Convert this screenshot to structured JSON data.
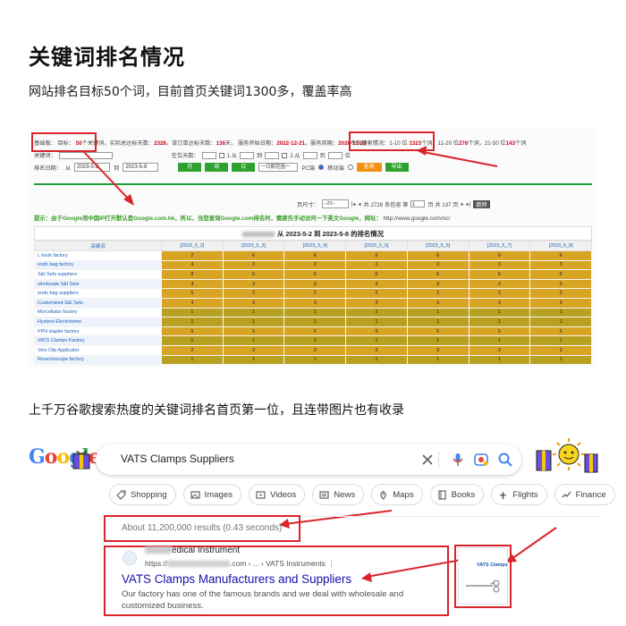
{
  "page": {
    "title": "关键词排名情况",
    "subtitle": "网站排名目标50个词，目前首页关键词1300多，覆盖率高",
    "section2_heading": "上千万谷歌搜索热度的关键词排名首页第一位，且连带图片也有收录"
  },
  "rank_panel": {
    "basic_label": "基础版：",
    "target_label": "目标：",
    "target_value": "50",
    "target_suffix": "个关键词",
    "days_text": "，实际总达标天数：",
    "days_value": "2328",
    "left_days_text": "，该订单达标天数：",
    "left_days_value": "136",
    "days_unit": "天，",
    "service_start_label": "服务开始日期：",
    "service_start": "2022-12-21",
    "service_end_label": "，服务到期：",
    "service_end": "2026-12-20",
    "today_label": "今日搜索情况：1-10 位",
    "today_top10": "1323",
    "today_mid_text": "个词，11-20 位",
    "today_11_20": "276",
    "today_mid2_text": "个词，21-50 位",
    "today_21_50": "143",
    "today_tail": "个词",
    "keyword_label": "关键词：",
    "position_label": "在位天数：",
    "range_label": "1.从",
    "to_label": "到",
    "range2_label": "2.从",
    "pos_unit": "位",
    "date_label": "排名日期：",
    "from_label": "从",
    "date_from": "2023-5-2",
    "date_to": "2023-5-8",
    "btn_month": "月",
    "btn_week": "周",
    "btn_day": "日",
    "period_select": "一日期范围一",
    "pc_label": "PC端",
    "mobile_label": "移动端",
    "btn_query": "查询",
    "btn_export": "导出",
    "pager_size_label": "页尺寸：",
    "pager_size": "--20--",
    "pager_total": "共 2728 条信息 第",
    "pager_page": "1",
    "pager_pages": "页 共 137 页",
    "pager_go": "跳转",
    "tip": "提示：由于Google用中国IP打开默认是Google.com.hk，所以，当您查询Google.com排名时，需要先手动访问一下英文Google，网址：",
    "tip_url": "http://www.google.com/ncr",
    "table_title": "从 2023-5-2 到 2023-5-8 的排名情况",
    "columns": [
      "关键词",
      "[2023_5_2]",
      "[2023_5_3]",
      "[2023_5_4]",
      "[2023_5_5]",
      "[2023_5_6]",
      "[2023_5_7]",
      "[2023_5_8]"
    ],
    "rows": [
      {
        "kw": "L hook factory",
        "v": [
          "2",
          "6",
          "6",
          "6",
          "6",
          "6",
          "6"
        ]
      },
      {
        "kw": "endo bag factory",
        "v": [
          "4",
          "3",
          "3",
          "3",
          "3",
          "3",
          "3"
        ]
      },
      {
        "kw": "S&I Sets suppliers",
        "v": [
          "8",
          "6",
          "6",
          "6",
          "6",
          "6",
          "6"
        ]
      },
      {
        "kw": "wholesale S&I Sets",
        "v": [
          "4",
          "3",
          "3",
          "3",
          "3",
          "3",
          "3"
        ]
      },
      {
        "kw": "endo bag suppliers",
        "v": [
          "5",
          "2",
          "2",
          "2",
          "2",
          "2",
          "2"
        ]
      },
      {
        "kw": "Customized S&I Sets",
        "v": [
          "4",
          "3",
          "3",
          "3",
          "3",
          "3",
          "3"
        ]
      },
      {
        "kw": "Morcellator factory",
        "v": [
          "1",
          "1",
          "1",
          "1",
          "1",
          "1",
          "1"
        ]
      },
      {
        "kw": "Hystero-Electrotome",
        "v": [
          "1",
          "1",
          "1",
          "1",
          "1",
          "1",
          "1"
        ]
      },
      {
        "kw": "PPH stapler factory",
        "v": [
          "5",
          "5",
          "5",
          "5",
          "5",
          "5",
          "5"
        ]
      },
      {
        "kw": "VATS Clamps Factory",
        "v": [
          "1",
          "1",
          "1",
          "1",
          "1",
          "1",
          "1"
        ]
      },
      {
        "kw": "Vein Clip Applicator",
        "v": [
          "2",
          "3",
          "3",
          "3",
          "3",
          "3",
          "3"
        ]
      },
      {
        "kw": "Resectoscope factory",
        "v": [
          "1",
          "1",
          "1",
          "1",
          "1",
          "1",
          "1"
        ]
      }
    ]
  },
  "google": {
    "logo": "Google",
    "query": "VATS Clamps Suppliers",
    "chips": [
      {
        "label": "Shopping",
        "icon": "tag-icon"
      },
      {
        "label": "Images",
        "icon": "image-icon"
      },
      {
        "label": "Videos",
        "icon": "play-icon"
      },
      {
        "label": "News",
        "icon": "news-icon"
      },
      {
        "label": "Maps",
        "icon": "pin-icon"
      },
      {
        "label": "Books",
        "icon": "book-icon"
      },
      {
        "label": "Flights",
        "icon": "plane-icon"
      },
      {
        "label": "Finance",
        "icon": "trend-icon"
      }
    ],
    "results_count": "About 11,200,000 results (0.43 seconds)",
    "result": {
      "site_name_suffix": "edical Instrument",
      "url_prefix": "https://",
      "url_suffix": ".com › ... › VATS Instruments",
      "title": "VATS Clamps Manufacturers and Suppliers",
      "snippet": "Our factory has one of the famous brands and we deal with wholesale and customized business.",
      "thumb_label": "VATS Clamps"
    },
    "colors": {
      "link": "#1a0dab",
      "highlight_red": "#d9242a",
      "rank_gold": "#d7a523",
      "rank_green": "#1f9e3a"
    }
  }
}
